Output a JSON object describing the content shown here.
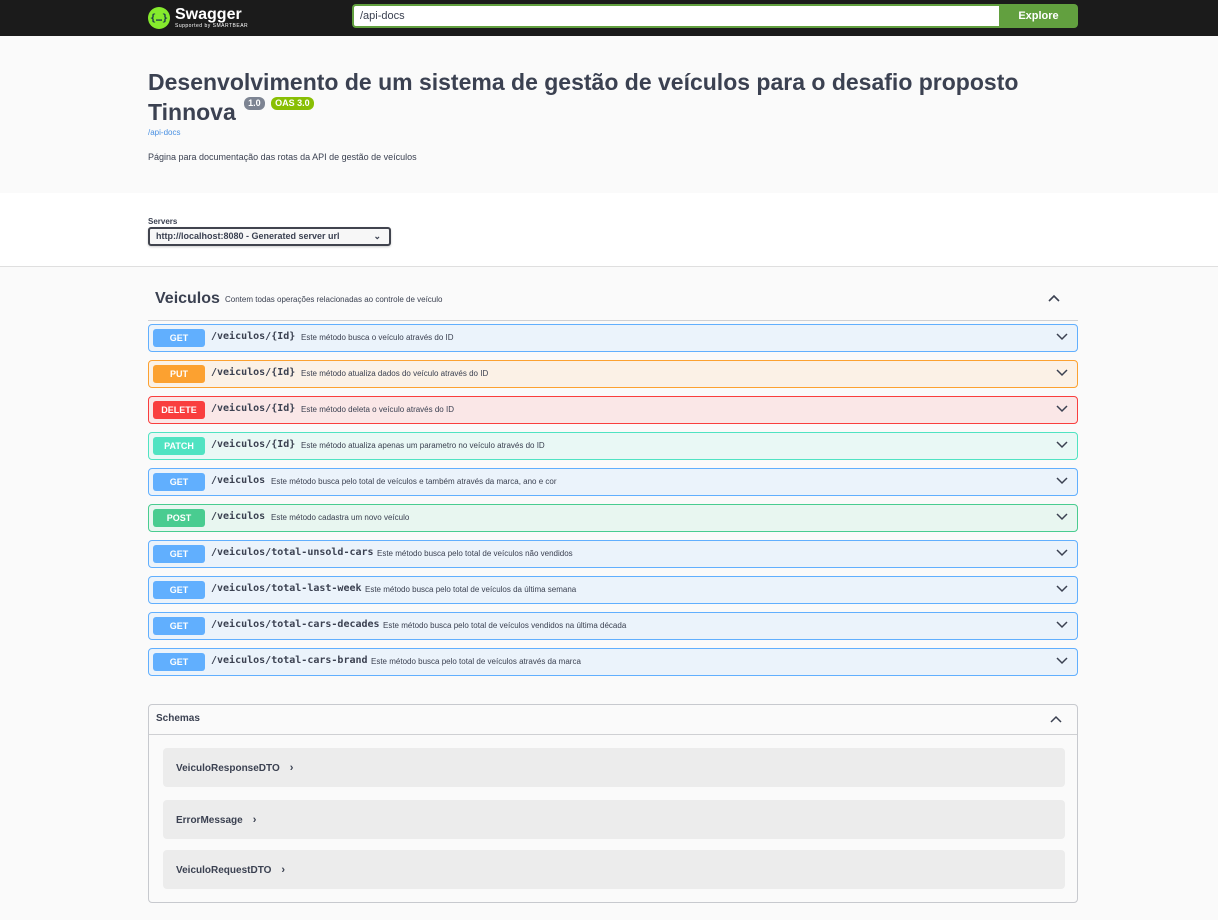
{
  "topbar": {
    "logo_text": "Swagger",
    "logo_subtext": "Supported by SMARTBEAR",
    "url_value": "/api-docs",
    "explore_label": "Explore"
  },
  "info": {
    "title": "Desenvolvimento de um sistema de gestão de veículos para o desafio proposto Tinnova",
    "version": "1.0",
    "oas": "OAS 3.0",
    "link": "/api-docs",
    "description": "Página para documentação das rotas da API de gestão de veículos"
  },
  "servers": {
    "label": "Servers",
    "selected": "http://localhost:8080 - Generated server url"
  },
  "tag": {
    "name": "Veiculos",
    "description": "Contem todas operações relacionadas ao controle de veículo"
  },
  "operations": [
    {
      "method": "GET",
      "path": "/veiculos/{Id}",
      "summary": "Este método busca o veículo através do ID"
    },
    {
      "method": "PUT",
      "path": "/veiculos/{Id}",
      "summary": "Este método atualiza dados do veículo através do ID"
    },
    {
      "method": "DELETE",
      "path": "/veiculos/{Id}",
      "summary": "Este método deleta o veículo através do ID"
    },
    {
      "method": "PATCH",
      "path": "/veiculos/{Id}",
      "summary": "Este método atualiza apenas um parametro no veículo através do ID"
    },
    {
      "method": "GET",
      "path": "/veiculos",
      "summary": "Este método busca pelo total de veículos e também através da marca, ano e cor"
    },
    {
      "method": "POST",
      "path": "/veiculos",
      "summary": "Este método cadastra um novo veículo"
    },
    {
      "method": "GET",
      "path": "/veiculos/total-unsold-cars",
      "summary": "Este método busca pelo total de veículos não vendidos"
    },
    {
      "method": "GET",
      "path": "/veiculos/total-last-week",
      "summary": "Este método busca pelo total de veículos da última semana"
    },
    {
      "method": "GET",
      "path": "/veiculos/total-cars-decades",
      "summary": "Este método busca pelo total de veículos vendidos na última década"
    },
    {
      "method": "GET",
      "path": "/veiculos/total-cars-brand",
      "summary": "Este método busca pelo total de veículos através da marca"
    }
  ],
  "schemas": {
    "title": "Schemas",
    "models": [
      {
        "name": "VeiculoResponseDTO"
      },
      {
        "name": "ErrorMessage"
      },
      {
        "name": "VeiculoRequestDTO"
      }
    ]
  },
  "colors": {
    "get": "#61affe",
    "put": "#fca130",
    "delete": "#f93e3e",
    "patch": "#50e3c2",
    "post": "#49cc90",
    "explore": "#62a03f"
  }
}
